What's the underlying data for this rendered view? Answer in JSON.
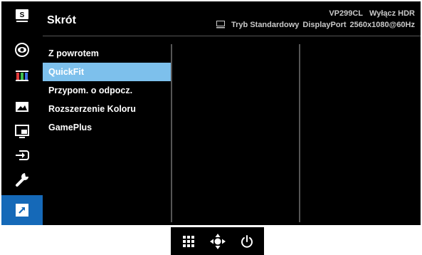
{
  "header": {
    "title": "Skrót",
    "model": "VP299CL",
    "hdr_status": "Wyłącz HDR",
    "mode": "Tryb Standardowy",
    "input": "DisplayPort",
    "resolution": "2560x1080@60Hz"
  },
  "sidebar": {
    "items": [
      {
        "name": "splendid",
        "icon": "splendid-icon"
      },
      {
        "name": "blue-light-filter",
        "icon": "eye-icon"
      },
      {
        "name": "color",
        "icon": "color-bars-icon"
      },
      {
        "name": "image",
        "icon": "image-icon"
      },
      {
        "name": "pip-pbp",
        "icon": "pip-icon"
      },
      {
        "name": "input-select",
        "icon": "input-icon"
      },
      {
        "name": "system-setup",
        "icon": "wrench-icon"
      },
      {
        "name": "shortcut",
        "icon": "shortcut-icon",
        "active": true
      }
    ]
  },
  "menu": {
    "items": [
      {
        "label": "Z powrotem"
      },
      {
        "label": "QuickFit",
        "selected": true
      },
      {
        "label": "Przypom. o odpocz."
      },
      {
        "label": "Rozszerzenie Koloru"
      },
      {
        "label": "GamePlus"
      }
    ]
  },
  "controls": [
    {
      "icon": "menu-grid-icon"
    },
    {
      "icon": "five-way-joystick-icon"
    },
    {
      "icon": "power-icon"
    }
  ],
  "colors": {
    "background": "#000000",
    "accent_active": "#1569b8",
    "selected_item": "#7dc0ec",
    "text": "#ffffff",
    "header_info": "#c9c9c9"
  }
}
